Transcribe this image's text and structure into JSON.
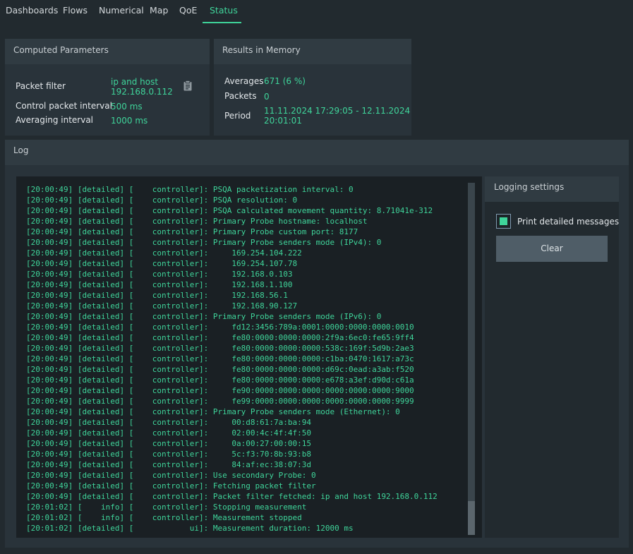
{
  "nav": {
    "tabs": [
      {
        "label": "Dashboards"
      },
      {
        "label": "Flows"
      },
      {
        "label": "Numerical"
      },
      {
        "label": "Map"
      },
      {
        "label": "QoE"
      },
      {
        "label": "Status"
      }
    ],
    "active": "Status",
    "accent": "#3fd49a"
  },
  "computed": {
    "title": "Computed Parameters",
    "packet_filter_label": "Packet filter",
    "packet_filter_line1": "ip and host",
    "packet_filter_line2": "192.168.0.112",
    "control_interval_label": "Control packet interval",
    "control_interval_value": "500 ms",
    "averaging_interval_label": "Averaging interval",
    "averaging_interval_value": "1000 ms",
    "copy_icon": "clipboard-icon"
  },
  "memory": {
    "title": "Results in Memory",
    "averages_label": "Averages",
    "averages_value": "671 (6 %)",
    "packets_label": "Packets",
    "packets_value": "0",
    "period_label": "Period",
    "period_line1": "11.11.2024 17:29:05 - 12.11.2024",
    "period_line2": "20:01:01"
  },
  "log": {
    "title": "Log",
    "lines": [
      "[20:00:49] [detailed] [    controller]: PSQA packetization interval: 0",
      "[20:00:49] [detailed] [    controller]: PSQA resolution: 0",
      "[20:00:49] [detailed] [    controller]: PSQA calculated movement quantity: 8.71041e-312",
      "[20:00:49] [detailed] [    controller]: Primary Probe hostname: localhost",
      "[20:00:49] [detailed] [    controller]: Primary Probe custom port: 8177",
      "[20:00:49] [detailed] [    controller]: Primary Probe senders mode (IPv4): 0",
      "[20:00:49] [detailed] [    controller]:     169.254.104.222",
      "[20:00:49] [detailed] [    controller]:     169.254.107.78",
      "[20:00:49] [detailed] [    controller]:     192.168.0.103",
      "[20:00:49] [detailed] [    controller]:     192.168.1.100",
      "[20:00:49] [detailed] [    controller]:     192.168.56.1",
      "[20:00:49] [detailed] [    controller]:     192.168.90.127",
      "[20:00:49] [detailed] [    controller]: Primary Probe senders mode (IPv6): 0",
      "[20:00:49] [detailed] [    controller]:     fd12:3456:789a:0001:0000:0000:0000:0010",
      "[20:00:49] [detailed] [    controller]:     fe80:0000:0000:0000:2f9a:6ec0:fe65:9ff4",
      "[20:00:49] [detailed] [    controller]:     fe80:0000:0000:0000:538c:169f:5d9b:2ae3",
      "[20:00:49] [detailed] [    controller]:     fe80:0000:0000:0000:c1ba:0470:1617:a73c",
      "[20:00:49] [detailed] [    controller]:     fe80:0000:0000:0000:d69c:0ead:a3ab:f520",
      "[20:00:49] [detailed] [    controller]:     fe80:0000:0000:0000:e678:a3ef:d90d:c61a",
      "[20:00:49] [detailed] [    controller]:     fe90:0000:0000:0000:0000:0000:0000:9000",
      "[20:00:49] [detailed] [    controller]:     fe99:0000:0000:0000:0000:0000:0000:9999",
      "[20:00:49] [detailed] [    controller]: Primary Probe senders mode (Ethernet): 0",
      "[20:00:49] [detailed] [    controller]:     00:d8:61:7a:ba:94",
      "[20:00:49] [detailed] [    controller]:     02:00:4c:4f:4f:50",
      "[20:00:49] [detailed] [    controller]:     0a:00:27:00:00:15",
      "[20:00:49] [detailed] [    controller]:     5c:f3:70:8b:93:b8",
      "[20:00:49] [detailed] [    controller]:     84:af:ec:38:07:3d",
      "[20:00:49] [detailed] [    controller]: Use secondary Probe: 0",
      "[20:00:49] [detailed] [    controller]: Fetching packet filter",
      "[20:00:49] [detailed] [    controller]: Packet filter fetched: ip and host 192.168.0.112",
      "[20:01:02] [    info] [    controller]: Stopping measurement",
      "[20:01:02] [    info] [    controller]: Measurement stopped",
      "[20:01:02] [detailed] [            ui]: Measurement duration: 12000 ms"
    ]
  },
  "settings": {
    "title": "Logging settings",
    "print_detailed_label": "Print detailed messages",
    "print_detailed_checked": true,
    "clear_label": "Clear"
  }
}
